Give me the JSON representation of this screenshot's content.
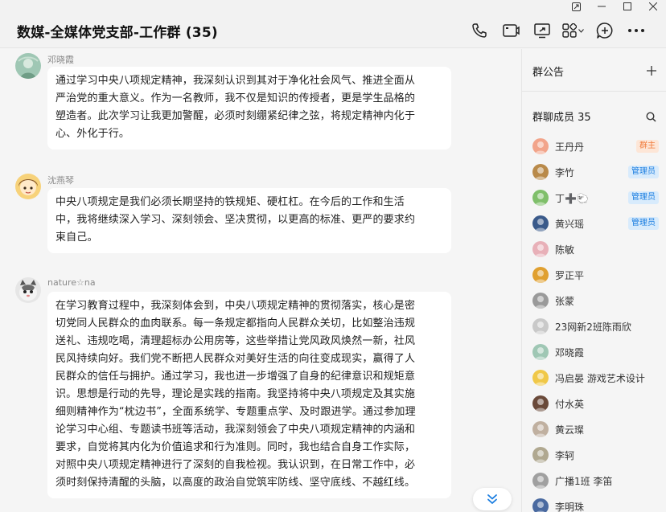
{
  "chat": {
    "title": "数媒-全媒体党支部-工作群 (35)"
  },
  "messages": [
    {
      "sender": "邓晓霞",
      "lines": [
        "通过学习中央八项规定精神，我深刻认识到其对于净化社会风气、推进全面从",
        "严治党的重大意义。作为一名教师，我不仅是知识的传授者，更是学生品格的",
        "塑造者。此次学习让我更加警醒，必须时刻绷紧纪律之弦，将规定精神内化于",
        "心、外化于行。"
      ]
    },
    {
      "sender": "沈燕琴",
      "lines": [
        "中央八项规定是我们必须长期坚持的铁规矩、硬杠杠。在今后的工作和生活",
        "中，我将继续深入学习、深刻领会、坚决贯彻，以更高的标准、更严的要求约",
        "束自己。"
      ]
    },
    {
      "sender": "nature☆na",
      "lines": [
        "在学习教育过程中，我深刻体会到，中央八项规定精神的贯彻落实，核心是密",
        "切党同人民群众的血肉联系。每一条规定都指向人民群众关切，比如整治违规",
        "送礼、违规吃喝，清理超标办公用房等，这些举措让党风政风焕然一新，社风",
        "民风持续向好。我们党不断把人民群众对美好生活的向往变成现实，赢得了人",
        "民群众的信任与拥护。通过学习，我也进一步增强了自身的纪律意识和规矩意",
        "识。思想是行动的先导，理论是实践的指南。我坚持将中央八项规定及其实施",
        "细则精神作为“枕边书”，全面系统学、专题重点学、及时跟进学。通过参加理",
        "论学习中心组、专题读书班等活动，我深刻领会了中央八项规定精神的内涵和",
        "要求，自觉将其内化为价值追求和行为准则。同时，我也结合自身工作实际，",
        "对照中央八项规定精神进行了深刻的自我检视。我认识到，在日常工作中，必",
        "须时刻保持清醒的头脑，以高度的政治自觉筑牢防线、坚守底线、不越红线。"
      ]
    }
  ],
  "sidebar": {
    "announcement_title": "群公告",
    "members_title": "群聊成员 35",
    "members": [
      {
        "name": "王丹丹",
        "badge": "群主",
        "badge_type": "owner"
      },
      {
        "name": "李竹",
        "badge": "管理员",
        "badge_type": "admin"
      },
      {
        "name": "丁➕🐑",
        "badge": "管理员",
        "badge_type": "admin"
      },
      {
        "name": "黄兴瑶",
        "badge": "管理员",
        "badge_type": "admin"
      },
      {
        "name": "陈敏",
        "badge": "",
        "badge_type": ""
      },
      {
        "name": "罗正平",
        "badge": "",
        "badge_type": ""
      },
      {
        "name": "张蒙",
        "badge": "",
        "badge_type": ""
      },
      {
        "name": "23网新2班陈雨欣",
        "badge": "",
        "badge_type": ""
      },
      {
        "name": "邓晓霞",
        "badge": "",
        "badge_type": ""
      },
      {
        "name": "冯启晏 游戏艺术设计",
        "badge": "",
        "badge_type": ""
      },
      {
        "name": "付水英",
        "badge": "",
        "badge_type": ""
      },
      {
        "name": "黄云璨",
        "badge": "",
        "badge_type": ""
      },
      {
        "name": "李轲",
        "badge": "",
        "badge_type": ""
      },
      {
        "name": "广播1班 李笛",
        "badge": "",
        "badge_type": ""
      },
      {
        "name": "李明珠",
        "badge": "",
        "badge_type": ""
      }
    ]
  },
  "colors": {
    "owner_badge": "#f07a3a",
    "admin_badge": "#1a7de0",
    "bubble": "#ffffff",
    "background": "#f5f5f5"
  }
}
